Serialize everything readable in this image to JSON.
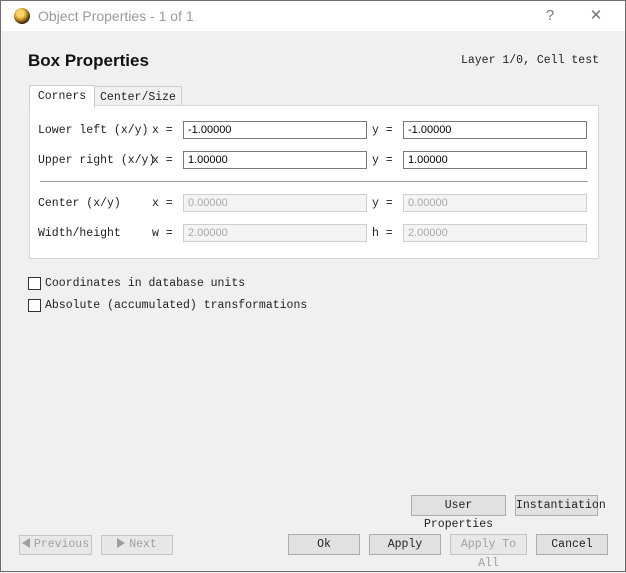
{
  "window": {
    "title": "Object Properties - 1 of 1",
    "help_label": "?",
    "close_label": "✕"
  },
  "header": {
    "heading": "Box Properties",
    "layer_info": "Layer 1/0, Cell test"
  },
  "tabs": [
    {
      "label": "Corners",
      "active": true
    },
    {
      "label": "Center/Size",
      "active": false
    }
  ],
  "corners": {
    "lower_left": {
      "label": "Lower left (x/y)",
      "x_label": "x =",
      "x_value": "-1.00000",
      "y_label": "y =",
      "y_value": "-1.00000"
    },
    "upper_right": {
      "label": "Upper right (x/y)",
      "x_label": "x =",
      "x_value": "1.00000",
      "y_label": "y =",
      "y_value": "1.00000"
    },
    "center": {
      "label": "Center (x/y)",
      "x_label": "x =",
      "x_value": "0.00000",
      "y_label": "y =",
      "y_value": "0.00000"
    },
    "size": {
      "label": "Width/height",
      "w_label": "w =",
      "w_value": "2.00000",
      "h_label": "h =",
      "h_value": "2.00000"
    }
  },
  "options": {
    "dbu_label": "Coordinates in database units",
    "dbu_checked": false,
    "abs_label": "Absolute (accumulated) transformations",
    "abs_checked": false
  },
  "buttons": {
    "user_properties": "User Properties",
    "instantiation": "Instantiation",
    "previous": "Previous",
    "next": "Next",
    "ok": "Ok",
    "apply": "Apply",
    "apply_to_all": "Apply To All",
    "cancel": "Cancel"
  }
}
